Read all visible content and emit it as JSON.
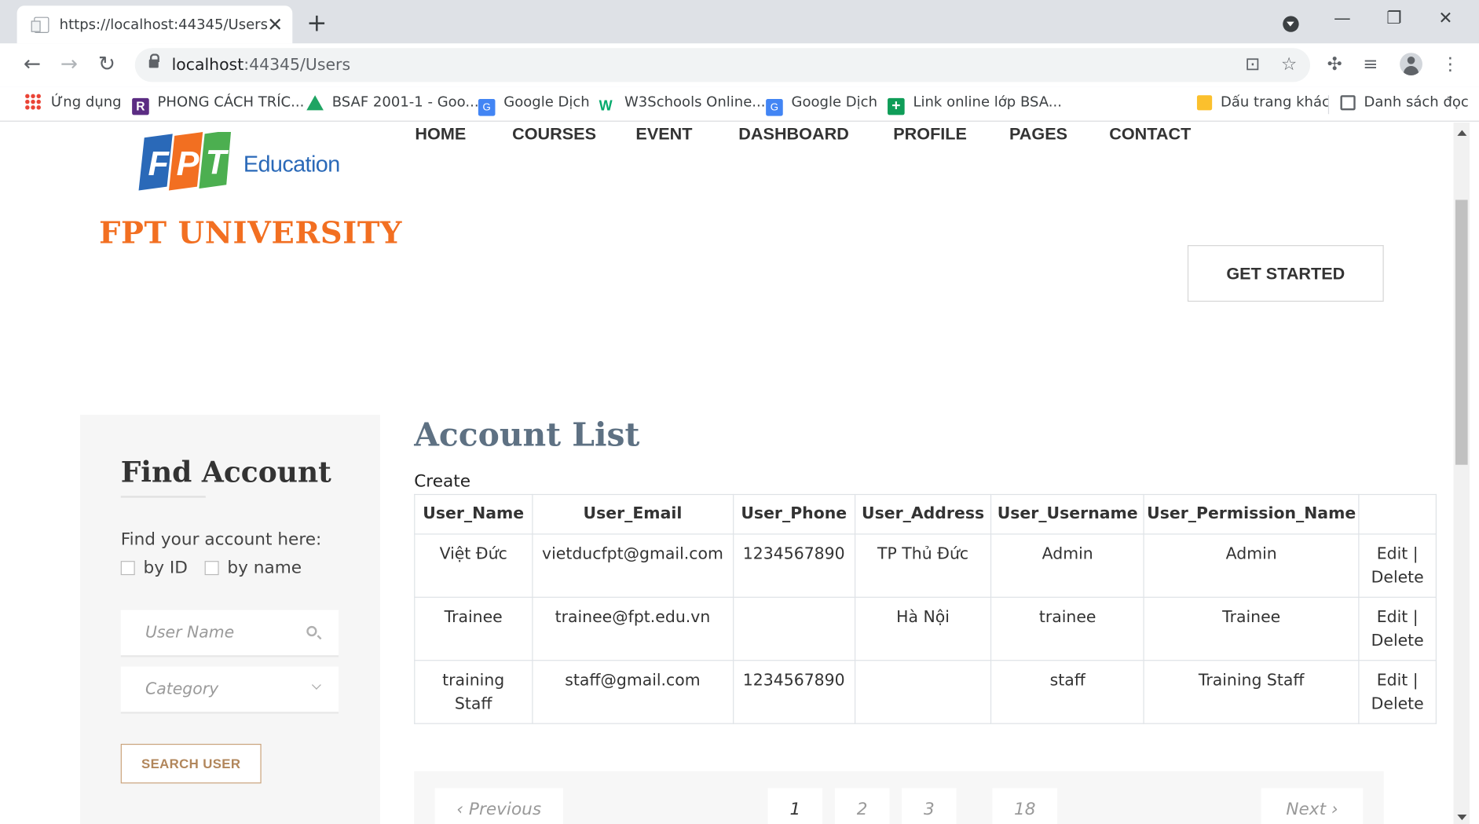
{
  "browser": {
    "tab_title": "https://localhost:44345/Users",
    "new_tab_label": "+",
    "url_host": "localhost",
    "url_rest": ":44345/Users"
  },
  "bookmarks": [
    {
      "label": "Ứng dụng",
      "icon": "apps-grid-icon"
    },
    {
      "label": "PHONG CÁCH TRÍC...",
      "icon": "r-logo-icon"
    },
    {
      "label": "BSAF 2001-1 - Goo...",
      "icon": "google-drive-icon"
    },
    {
      "label": "Google Dịch",
      "icon": "google-translate-icon"
    },
    {
      "label": "W3Schools Online...",
      "icon": "w3schools-icon"
    },
    {
      "label": "Google Dịch",
      "icon": "google-translate-icon"
    },
    {
      "label": "Link online lớp BSA...",
      "icon": "plus-sheet-icon"
    },
    {
      "label": "Dấu trang khác",
      "icon": "folder-icon"
    },
    {
      "label": "Danh sách đọc",
      "icon": "reading-list-icon"
    }
  ],
  "site": {
    "logo_edu": "Education",
    "logo_univ": "FPT UNIVERSITY",
    "nav": [
      "HOME",
      "COURSES",
      "EVENT",
      "DASHBOARD",
      "PROFILE",
      "PAGES",
      "CONTACT"
    ],
    "cta": "GET STARTED"
  },
  "sidebar": {
    "title": "Find Account",
    "label": "Find your account here:",
    "check_id": "by ID",
    "check_name": "by name",
    "search_placeholder": "User Name",
    "category_placeholder": "Category",
    "button": "SEARCH USER"
  },
  "accounts": {
    "title": "Account List",
    "create": "Create",
    "headers": [
      "User_Name",
      "User_Email",
      "User_Phone",
      "User_Address",
      "User_Username",
      "User_Permission_Name",
      ""
    ],
    "rows": [
      {
        "name": "Việt Đức",
        "email": "vietducfpt@gmail.com",
        "phone": "1234567890",
        "address": "TP Thủ Đức",
        "username": "Admin",
        "permission": "Admin",
        "edit": "Edit |",
        "delete": "Delete"
      },
      {
        "name": "Trainee",
        "email": "trainee@fpt.edu.vn",
        "phone": "",
        "address": "Hà Nội",
        "username": "trainee",
        "permission": "Trainee",
        "edit": "Edit |",
        "delete": "Delete"
      },
      {
        "name": "training Staff",
        "email": "staff@gmail.com",
        "phone": "1234567890",
        "address": "",
        "username": "staff",
        "permission": "Training Staff",
        "edit": "Edit |",
        "delete": "Delete"
      }
    ]
  },
  "pagination": {
    "previous": "‹  Previous",
    "pages": [
      "1",
      "2",
      "3",
      "18"
    ],
    "current": "1",
    "next": "Next  ›"
  },
  "colors": {
    "logo_orange": "#f26f21",
    "logo_blue": "#2a69b8",
    "logo_green": "#4caf50",
    "title_blue_gray": "#5e7183",
    "button_tan": "#b1865b"
  }
}
